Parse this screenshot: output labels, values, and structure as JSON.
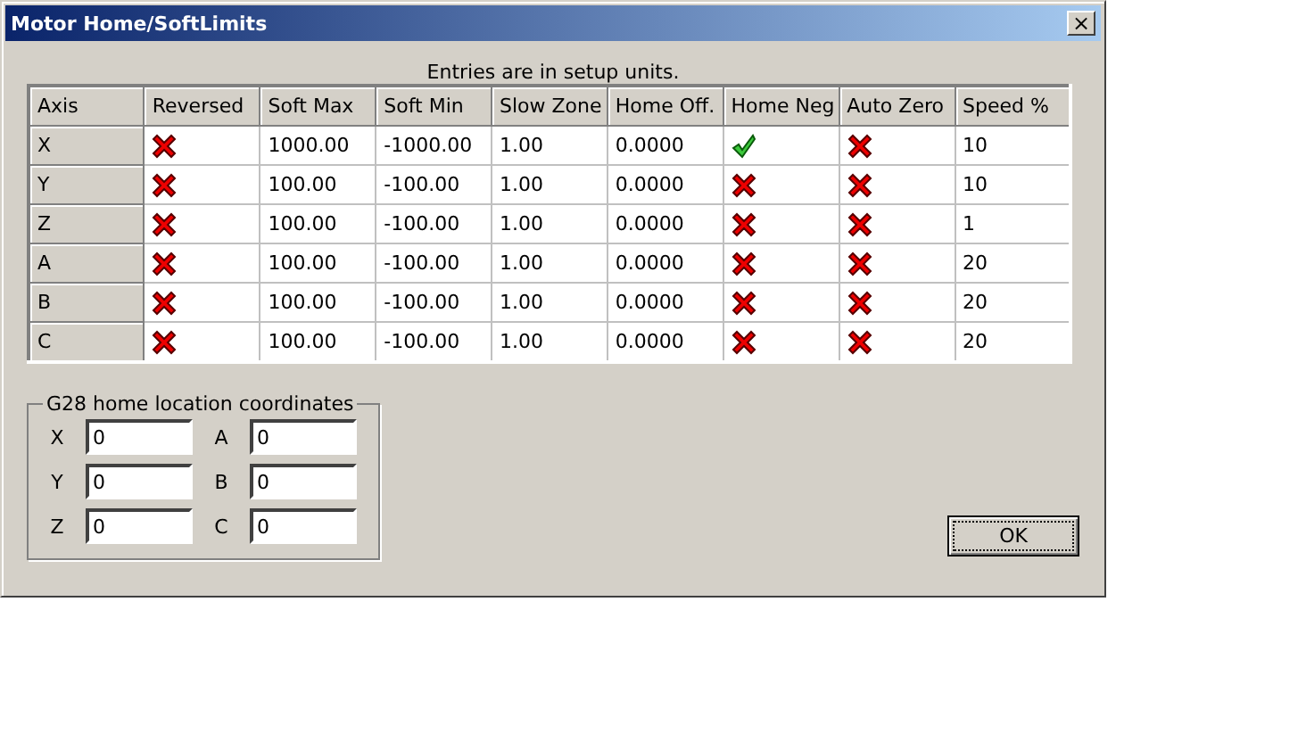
{
  "window": {
    "title": "Motor Home/SoftLimits",
    "close": "×"
  },
  "note": "Entries are in setup units.",
  "table": {
    "columns": [
      "Axis",
      "Reversed",
      "Soft Max",
      "Soft Min",
      "Slow Zone",
      "Home Off.",
      "Home Neg",
      "Auto Zero",
      "Speed %"
    ],
    "rows": [
      {
        "axis": "X",
        "reversed": false,
        "soft_max": "1000.00",
        "soft_min": "-1000.00",
        "slow_zone": "1.00",
        "home_off": "0.0000",
        "home_neg": true,
        "auto_zero": false,
        "speed": "10"
      },
      {
        "axis": "Y",
        "reversed": false,
        "soft_max": "100.00",
        "soft_min": "-100.00",
        "slow_zone": "1.00",
        "home_off": "0.0000",
        "home_neg": false,
        "auto_zero": false,
        "speed": "10"
      },
      {
        "axis": "Z",
        "reversed": false,
        "soft_max": "100.00",
        "soft_min": "-100.00",
        "slow_zone": "1.00",
        "home_off": "0.0000",
        "home_neg": false,
        "auto_zero": false,
        "speed": "1"
      },
      {
        "axis": "A",
        "reversed": false,
        "soft_max": "100.00",
        "soft_min": "-100.00",
        "slow_zone": "1.00",
        "home_off": "0.0000",
        "home_neg": false,
        "auto_zero": false,
        "speed": "20"
      },
      {
        "axis": "B",
        "reversed": false,
        "soft_max": "100.00",
        "soft_min": "-100.00",
        "slow_zone": "1.00",
        "home_off": "0.0000",
        "home_neg": false,
        "auto_zero": false,
        "speed": "20"
      },
      {
        "axis": "C",
        "reversed": false,
        "soft_max": "100.00",
        "soft_min": "-100.00",
        "slow_zone": "1.00",
        "home_off": "0.0000",
        "home_neg": false,
        "auto_zero": false,
        "speed": "20"
      }
    ]
  },
  "g28": {
    "title": "G28 home location coordinates",
    "fields": [
      {
        "label": "X",
        "value": "0"
      },
      {
        "label": "A",
        "value": "0"
      },
      {
        "label": "Y",
        "value": "0"
      },
      {
        "label": "B",
        "value": "0"
      },
      {
        "label": "Z",
        "value": "0"
      },
      {
        "label": "C",
        "value": "0"
      }
    ]
  },
  "buttons": [
    "OK"
  ]
}
